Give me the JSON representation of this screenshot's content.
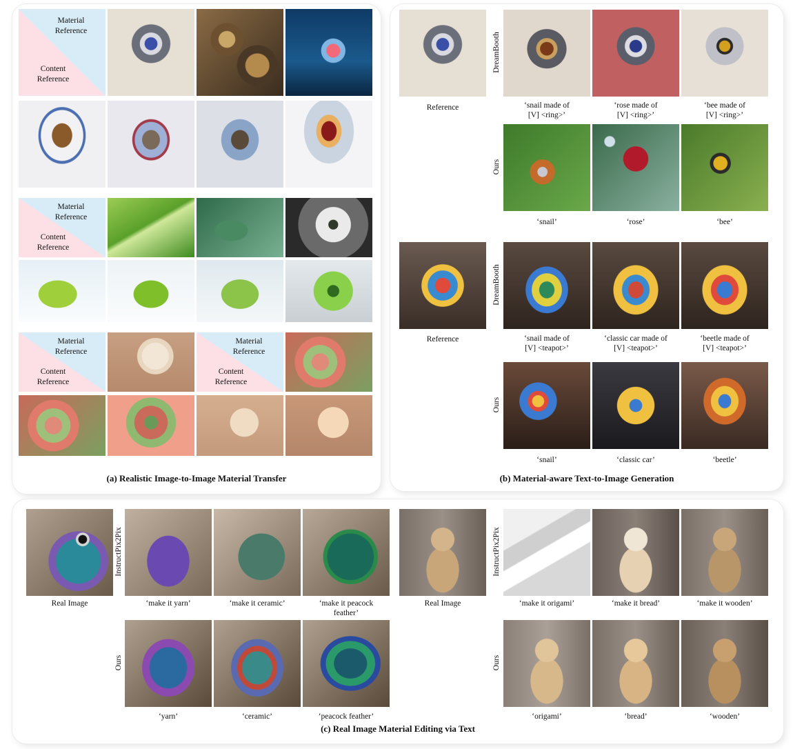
{
  "panels": {
    "a": "(a) Realistic Image-to-Image Material Transfer",
    "b": "(b) Material-aware Text-to-Image Generation",
    "c": "(c) Real Image Material Editing via Text"
  },
  "diag": {
    "material": "Material\nReference",
    "content": "Content\nReference"
  },
  "b": {
    "reference": "Reference",
    "dreambooth": "DreamBooth",
    "ours": "Ours",
    "ring_prompts": [
      "‘snail made of\n[V] <ring>’",
      "‘rose made of\n[V] <ring>’",
      "‘bee made of\n[V] <ring>’"
    ],
    "ring_ours": [
      "‘snail’",
      "‘rose’",
      "‘bee’"
    ],
    "teapot_prompts": [
      "‘snail made of\n[V] <teapot>’",
      "‘classic car made of\n[V] <teapot>’",
      "‘beetle made of\n[V] <teapot>’"
    ],
    "teapot_ours": [
      "‘snail’",
      "‘classic car’",
      "‘beetle’"
    ]
  },
  "c": {
    "real_image": "Real Image",
    "instructpix2pix": "InstructPix2Pix",
    "ours": "Ours",
    "bird_ip2p": [
      "‘make it yarn’",
      "‘make it ceramic’",
      "‘make it peacock\nfeather’"
    ],
    "bird_ours": [
      "‘yarn’",
      "‘ceramic’",
      "‘peacock feather’"
    ],
    "bear_ip2p": [
      "‘make it origami’",
      "‘make it bread’",
      "‘make it wooden’"
    ],
    "bear_ours": [
      "‘origami’",
      "‘bread’",
      "‘wooden’"
    ]
  },
  "images": [
    {
      "name": "ring-photo",
      "bg": "radial-gradient(circle at 50% 40%, #3a4fa8 0 9%, #d9d9e0 10% 16%, #6b6f7a 17% 28%, #e6dfd3 29% 100%)"
    },
    {
      "name": "gears-photo",
      "bg": "radial-gradient(circle at 35% 35%, #c9a768 0 10%, #6d5030 11% 20%, transparent 21%), radial-gradient(circle at 70% 65%, #b48a4d 0 14%, #4a3826 15% 24%, transparent 25%), linear-gradient(135deg,#8a6b45,#3a2c1e)"
    },
    {
      "name": "crystal-photo",
      "bg": "radial-gradient(circle at 55% 48%, #f26a7a 0 10%, #7fb6e4 11% 18%, transparent 19%), linear-gradient(180deg,#0f3a66,#1a5a8c 60%,#0a2540)"
    },
    {
      "name": "teacup-photo",
      "bg": "radial-gradient(ellipse at 50% 40%, #8a5a2a 0 16%, #f2f2f4 17% 34%, #4b6fb0 35% 38%, #f0f0f2 39% 100%)"
    },
    {
      "name": "teacup-ring-1",
      "bg": "radial-gradient(ellipse at 50% 45%, #7a6a5a 0 14%, #9fb0d6 15% 26%, #a23a4a 27% 30%, #e8e8ee 31% 100%)"
    },
    {
      "name": "teacup-gear-1",
      "bg": "radial-gradient(ellipse at 50% 45%, #5a4a3a 0 14%, #8aa4c8 15% 30%, #dcdfe6 31% 100%)"
    },
    {
      "name": "teacup-crystal-1",
      "bg": "radial-gradient(ellipse at 50% 35%, #8a1a1a 0 12%, #e8b060 13% 20%, #c9d4e0 21% 40%, #f4f4f6 41% 100%)"
    },
    {
      "name": "leaf-photo",
      "bg": "linear-gradient(150deg,#9ccc55 0%,#5aa02a 45%,#cfe89a 50%,#3e8a1f 100%)"
    },
    {
      "name": "lizard-photo",
      "bg": "radial-gradient(ellipse at 40% 55%, #4a8a62 0 22%, transparent 23%), linear-gradient(135deg,#2f6a4a,#77b092)"
    },
    {
      "name": "dandelion-photo",
      "bg": "radial-gradient(circle at 55% 45%, #2f3a2a 0 8%, #eaeaea 9% 30%, #6a6a6a 31% 60%, #2a2a2a 61% 100%)"
    },
    {
      "name": "apple-photo",
      "bg": "radial-gradient(ellipse at 45% 55%, #9fcf3a 0 28%, transparent 29%), linear-gradient(180deg,#e6f0f6,#fafcfd)"
    },
    {
      "name": "apple-leaf",
      "bg": "radial-gradient(ellipse at 50% 55%, #7fbf2a 0 28%, transparent 29%), linear-gradient(180deg,#eef3f6,#fafcfd)"
    },
    {
      "name": "apple-lizard",
      "bg": "radial-gradient(ellipse at 50% 55%, #8cc44a 0 30%, transparent 31%), linear-gradient(180deg,#dfe9ee,#f4f7f8)"
    },
    {
      "name": "apple-dandelion",
      "bg": "radial-gradient(circle at 55% 50%, #2f6a1f 0 10%, #8ad04a 11% 34%, transparent 35%), linear-gradient(180deg,#e4e9ec,#c9cfd3)"
    },
    {
      "name": "rose-photo",
      "bg": "radial-gradient(circle at 55% 40%, #f2e6d6 0 22%, #e9d6bf 23% 30%, transparent 31%), linear-gradient(180deg,#c79f82,#b68a6c)"
    },
    {
      "name": "succulent-photo",
      "bg": "radial-gradient(circle at 40% 50%, #e08a7a 0 14%, #9fc07a 15% 28%, #e07a6a 29% 42%, transparent 43%), linear-gradient(135deg,#c86a5a,#7aa060)"
    },
    {
      "name": "succulent-rose",
      "bg": "radial-gradient(circle at 50% 45%, #6a9a5a 0 12%, #c96a5a 13% 30%, #8fb870 31% 45%, #f0a08a 46% 100%)"
    },
    {
      "name": "rose-succulent-1",
      "bg": "radial-gradient(circle at 55% 45%, #f0dcc2 0 24%, transparent 25%), linear-gradient(180deg,#d5ae90,#c49a7c)"
    },
    {
      "name": "rose-succulent-2",
      "bg": "radial-gradient(circle at 55% 45%, #f4d8b8 0 26%, transparent 27%), linear-gradient(180deg,#c89878,#b4866a)"
    },
    {
      "name": "ring-snail-db",
      "bg": "radial-gradient(circle at 50% 45%, #7a3a1a 0 10%, #c9a060 11% 16%, #5a5a62 17% 30%, #e0d8cc 31% 100%)"
    },
    {
      "name": "ring-rose-db",
      "bg": "radial-gradient(circle at 50% 42%, #2a3a8a 0 9%, #dcdce2 10% 16%, #5a5e6a 17% 28%, #c06060 29% 100%)"
    },
    {
      "name": "ring-bee-db",
      "bg": "radial-gradient(circle at 50% 42%, #d4a020 0 8%, #2a2a2a 9% 12%, #c0c0c8 13% 28%, #e6e0d6 29% 100%)"
    },
    {
      "name": "snail-ring-ours",
      "bg": "radial-gradient(circle at 45% 55%, #c8c8d0 0 7%, #c46a2a 8% 18%, transparent 19%), linear-gradient(135deg,#3e7a2a,#6aa84a)"
    },
    {
      "name": "rose-ring-ours",
      "bg": "radial-gradient(circle at 50% 40%, #b01a2a 0 18%, transparent 19%), radial-gradient(circle at 20% 20%, #cfe0e8 0 5%, transparent 6%), linear-gradient(135deg,#3a6a4a,#8ab0a0)"
    },
    {
      "name": "bee-ring-ours",
      "bg": "radial-gradient(ellipse at 45% 45%, #e0b020 0 10%, #2a2a2a 11% 15%, transparent 16%), linear-gradient(135deg,#4a7a2a,#8ab050)"
    },
    {
      "name": "teapot-photo",
      "bg": "radial-gradient(ellipse at 50% 50%, #e04a3a 0 12%, #3a8ad0 13% 24%, #f0c040 25% 34%, transparent 35%), linear-gradient(180deg,#6a5a50,#3a2e28)"
    },
    {
      "name": "snail-teapot-db",
      "bg": "radial-gradient(ellipse at 50% 55%, #2f8a5a 0 12%, #e0d040 13% 24%, #3a7ad0 25% 34%, transparent 35%), linear-gradient(180deg,#5a4a40,#2e241e)"
    },
    {
      "name": "car-teapot-db",
      "bg": "radial-gradient(ellipse at 50% 55%, #d04a3a 0 12%, #3a8ad0 13% 22%, #f0c040 23% 36%, transparent 37%), linear-gradient(180deg,#5a4a40,#2e241e)"
    },
    {
      "name": "beetle-teapot-db",
      "bg": "radial-gradient(ellipse at 50% 55%, #3a7ad0 0 12%, #e04a3a 13% 22%, #f0c040 23% 36%, transparent 37%), linear-gradient(180deg,#5a4a40,#2e241e)"
    },
    {
      "name": "snail-teapot-ours",
      "bg": "radial-gradient(circle at 40% 45%, #f0c040 0 8%, #e04a3a 9% 14%, #3a7ad0 15% 26%, transparent 27%), linear-gradient(180deg,#6a4a3a,#2a1e18)"
    },
    {
      "name": "car-teapot-ours",
      "bg": "radial-gradient(ellipse at 50% 50%, #3a7ad0 0 10%, #f0c040 11% 30%, transparent 31%), linear-gradient(180deg,#3a3a40,#1a1a1e)"
    },
    {
      "name": "beetle-teapot-ours",
      "bg": "radial-gradient(ellipse at 50% 45%, #3a7ad0 0 10%, #f0c040 11% 22%, #d06a2a 23% 34%, transparent 35%), linear-gradient(180deg,#7a5a4a,#3a2a22)"
    },
    {
      "name": "bird-photo",
      "bg": "radial-gradient(circle at 65% 35%, #111 0 5%, #d8d8d8 6% 8%, transparent 9%), radial-gradient(ellipse at 60% 60%, #2a8a9a 0 30%, #7a5ab0 31% 40%, transparent 41%), linear-gradient(135deg,#b0a090,#6a5a4a)"
    },
    {
      "name": "bird-yarn-ip2p",
      "bg": "radial-gradient(ellipse at 50% 60%, #6a4ab0 0 34%, transparent 35%), linear-gradient(135deg,#c0b0a0,#7a6a5a)"
    },
    {
      "name": "bird-ceramic-ip2p",
      "bg": "radial-gradient(ellipse at 55% 55%, #4a7a6a 0 34%, transparent 35%), linear-gradient(135deg,#c8b8a8,#7a6a5a)"
    },
    {
      "name": "bird-peacock-ip2p",
      "bg": "radial-gradient(ellipse at 55% 55%, #1a6a5a 0 34%, #2a8a4a 35% 40%, transparent 41%), linear-gradient(135deg,#b8a898,#6a5a4a)"
    },
    {
      "name": "bird-yarn-ours",
      "bg": "radial-gradient(ellipse at 50% 55%, #2a6aa0 0 30%, #8a4ab0 31% 42%, transparent 43%), linear-gradient(135deg,#b0a090,#5a4a3a)"
    },
    {
      "name": "bird-ceramic-ours",
      "bg": "radial-gradient(ellipse at 50% 55%, #3a8a8a 0 24%, #c04a3a 25% 32%, #5a6ab0 33% 42%, transparent 43%), linear-gradient(135deg,#b0a090,#5a4a3a)"
    },
    {
      "name": "bird-peacock-ours",
      "bg": "radial-gradient(ellipse at 55% 50%, #1a5a6a 0 24%, #2a9a6a 25% 36%, #2a4aa0 37% 44%, transparent 45%), linear-gradient(135deg,#b0a090,#5a4a3a)"
    },
    {
      "name": "bear-photo",
      "bg": "radial-gradient(circle at 50% 35%, #d4b48a 0 16%, transparent 17%), radial-gradient(ellipse at 50% 70%, #c9a67a 0 26%, transparent 27%), linear-gradient(90deg,#7a7068,#9a9088 50%,#6a6058)"
    },
    {
      "name": "bear-origami-ip2p",
      "bg": "linear-gradient(150deg,#f0f0f0 0 30%,#cfcfcf 31% 45%,#ffffff 46% 60%,#d8d8d8 61% 100%)"
    },
    {
      "name": "bear-bread-ip2p",
      "bg": "radial-gradient(circle at 50% 35%, #f0e6d6 0 16%, transparent 17%), radial-gradient(ellipse at 50% 70%, #e6d2b2 0 26%, transparent 27%), linear-gradient(90deg,#6a605a,#8a8078 50%,#5a504a)"
    },
    {
      "name": "bear-wooden-ip2p",
      "bg": "radial-gradient(circle at 50% 35%, #c8a67a 0 16%, transparent 17%), radial-gradient(ellipse at 50% 70%, #b8966a 0 26%, transparent 27%), linear-gradient(90deg,#7a7068,#9a9088 50%,#6a6058)"
    },
    {
      "name": "bear-origami-ours",
      "bg": "radial-gradient(circle at 50% 35%, #e0c49a 0 16%, transparent 17%), radial-gradient(ellipse at 50% 70%, #d6b88a 0 26%, transparent 27%), linear-gradient(90deg,#8a8078,#aaa098 50%,#7a7068)"
    },
    {
      "name": "bear-bread-ours",
      "bg": "radial-gradient(circle at 50% 35%, #e6c89a 0 16%, transparent 17%), radial-gradient(ellipse at 50% 70%, #d8b484 0 26%, transparent 27%), linear-gradient(90deg,#7a7068,#9a9088 50%,#6a6058)"
    },
    {
      "name": "bear-wooden-ours",
      "bg": "radial-gradient(circle at 50% 35%, #c8a070 0 16%, transparent 17%), radial-gradient(ellipse at 50% 70%, #b89060 0 26%, transparent 27%), linear-gradient(90deg,#6a6058,#8a8078 50%,#5a5048)"
    }
  ]
}
